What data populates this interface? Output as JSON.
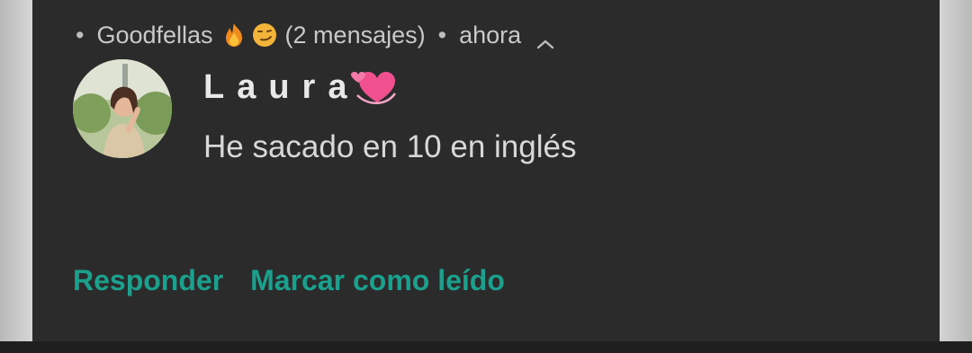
{
  "notification": {
    "group_name": "Goodfellas",
    "message_count_text": "(2 mensajes)",
    "time": "ahora",
    "sender": "Laura",
    "message": "He sacado en 10 en inglés",
    "header_icons": [
      "fire-icon",
      "smirk-face-icon",
      "chevron-up-icon"
    ],
    "sender_icon": "revolving-hearts-icon"
  },
  "actions": {
    "reply_label": "Responder",
    "mark_read_label": "Marcar como leído"
  },
  "colors": {
    "background": "#2b2b2b",
    "accent": "#1aa08c",
    "primary_text": "#e8e8e8",
    "secondary_text": "#c9c9c9"
  }
}
